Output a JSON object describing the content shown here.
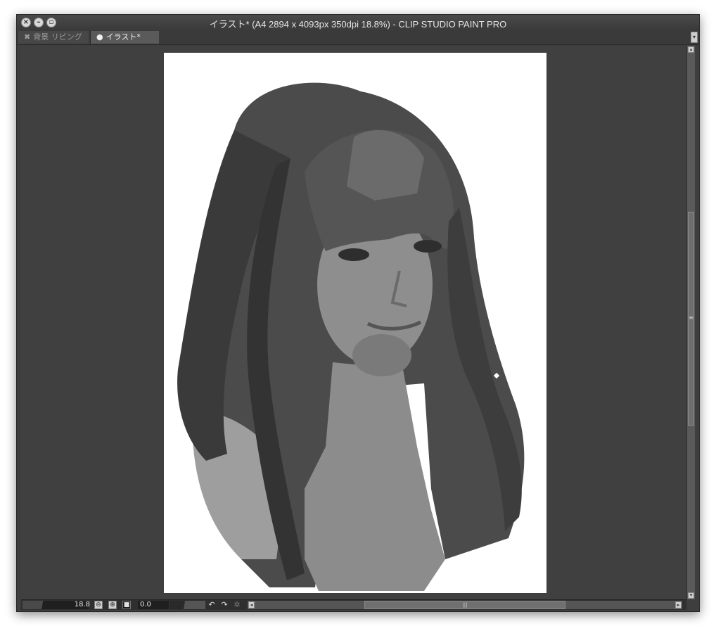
{
  "window": {
    "title": "イラスト* (A4 2894 x 4093px 350dpi 18.8%)  - CLIP STUDIO PAINT PRO",
    "controls": [
      "close-icon",
      "minimize-icon",
      "maximize-icon"
    ]
  },
  "tabs": [
    {
      "label": "背景 リビング",
      "active": false,
      "icon": "close-icon"
    },
    {
      "label": "イラスト*",
      "active": true,
      "icon": "dot-icon"
    }
  ],
  "canvas": {
    "image": "grayscale digital painting of a woman with long dark hair and bangs",
    "page_color": "#ffffff",
    "background_color": "#404040"
  },
  "status": {
    "zoom_value": "18.8",
    "rotation_value": "0.0"
  },
  "colors": {
    "chrome_dark": "#3e3e3e",
    "active_tab": "#5a5a5a",
    "title_text": "#e6e6e6"
  }
}
